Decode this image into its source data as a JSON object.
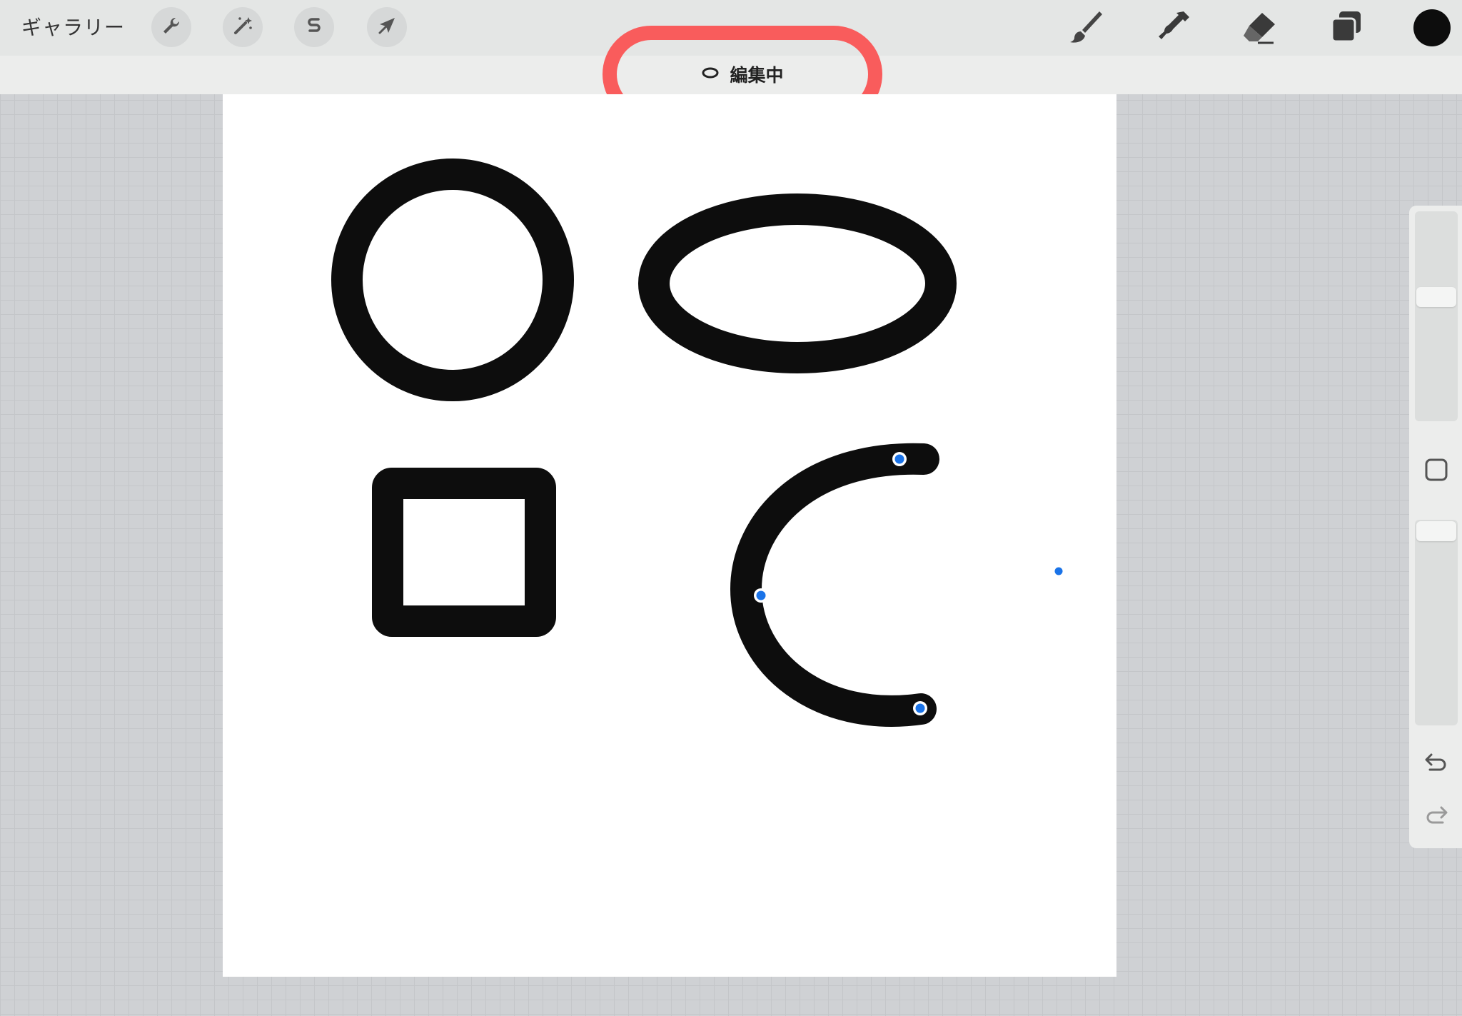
{
  "toolbar": {
    "gallery_label": "ギャラリー",
    "left_icons": [
      "wrench-icon",
      "magic-wand-icon",
      "selection-icon",
      "transform-arrow-icon"
    ],
    "right_icons": [
      "brush-icon",
      "smudge-icon",
      "eraser-icon",
      "layers-icon"
    ],
    "current_color": "#0d0d0d"
  },
  "edit_status": {
    "label": "編集中",
    "shape_icon": "ellipse-icon",
    "highlight_color": "#f95c5c"
  },
  "canvas": {
    "background": "#ffffff",
    "stroke_color": "#0d0d0d",
    "shapes": [
      "circle",
      "ellipse",
      "square",
      "arc"
    ],
    "control_point_color": "#1a73e8"
  },
  "sidebar": {
    "controls": [
      "brush-size-slider",
      "modify-button",
      "opacity-slider",
      "undo-button",
      "redo-button"
    ]
  }
}
